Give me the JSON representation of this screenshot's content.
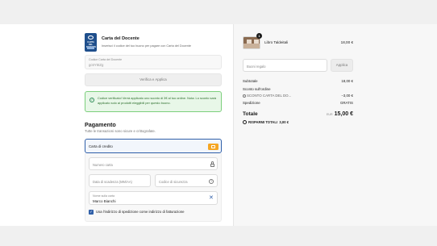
{
  "carta": {
    "logo_text": "CARTA DEL DOCENTE",
    "title": "Carta del Docente",
    "subtitle": "Inserisci il codice del tuo buono per pagare con Carta del Docente",
    "code_label": "Codice Carta del Docente",
    "code_value": "gc6Y5tZg",
    "verify_label": "Verifica e Applica",
    "success_message": "Codice verificato! Verrà applicato uno sconto di 3€ al tuo ordine. Nota: Lo sconto sarà applicato solo ai prodotti eleggibili per questo buono."
  },
  "payment": {
    "title": "Pagamento",
    "subtitle": "Tutte le transazioni sono sicure e crittografate.",
    "method_label": "Carta di credito",
    "card_number_placeholder": "Numero carta",
    "expiry_placeholder": "Data di scadenza (MM/AA)",
    "cvv_placeholder": "Codice di sicurezza",
    "name_label": "Nome sulla carta",
    "name_value": "Marco Bianchi",
    "billing_checkbox_label": "Usa l'indirizzo di spedizione come indirizzo di fatturazione",
    "billing_checked": true
  },
  "summary": {
    "item": {
      "quantity": "1",
      "name": "Libro Taldeitali",
      "price": "18,00 €"
    },
    "discount_placeholder": "Buoni regalo",
    "apply_label": "Applica",
    "subtotal_label": "Subtotale",
    "subtotal_value": "18,00 €",
    "order_discount_label": "Sconto sull'ordine",
    "discount_tag": "SCONTO CARTA DEL DO...",
    "discount_value": "−3,00 €",
    "shipping_label": "Spedizione",
    "shipping_value": "GRATIS",
    "total_label": "Totale",
    "currency": "EUR",
    "total_value": "15,00 €",
    "savings_label": "RISPARMI TOTALI",
    "savings_value": "3,00 €"
  }
}
